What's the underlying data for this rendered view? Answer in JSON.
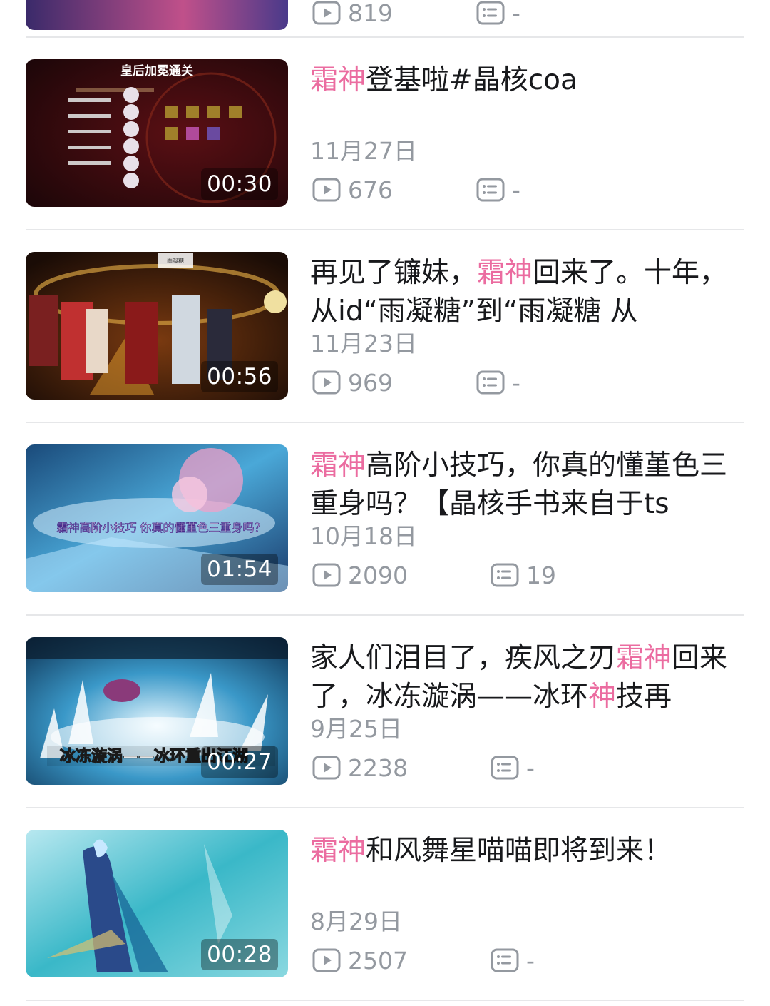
{
  "partial_top": {
    "views": "819",
    "comments": "-"
  },
  "videos": [
    {
      "title_parts": [
        {
          "text": "霜神",
          "hl": true
        },
        {
          "text": "登基啦#晶核coa",
          "hl": false
        }
      ],
      "duration": "00:30",
      "date": "11月27日",
      "views": "676",
      "comments": "-",
      "thumb_caption": "皇后加冕通关"
    },
    {
      "title_parts": [
        {
          "text": "再见了镰妹，",
          "hl": false
        },
        {
          "text": "霜神",
          "hl": true
        },
        {
          "text": "回来了。十年，从id“雨凝糖”到“雨凝糖 从",
          "hl": false
        }
      ],
      "duration": "00:56",
      "date": "11月23日",
      "views": "969",
      "comments": "-",
      "thumb_caption": "雨凝糖"
    },
    {
      "title_parts": [
        {
          "text": "霜神",
          "hl": true
        },
        {
          "text": "高阶小技巧，你真的懂堇色三重身吗？【晶核手书来自于ts",
          "hl": false
        }
      ],
      "duration": "01:54",
      "date": "10月18日",
      "views": "2090",
      "comments": "19",
      "thumb_caption": "霜神高阶小技巧 你真的懂堇色三重身吗？"
    },
    {
      "title_parts": [
        {
          "text": "家人们泪目了，疾风之刃",
          "hl": false
        },
        {
          "text": "霜神",
          "hl": true
        },
        {
          "text": "回来了，冰冻漩涡——冰环",
          "hl": false
        },
        {
          "text": "神",
          "hl": true
        },
        {
          "text": "技再",
          "hl": false
        }
      ],
      "duration": "00:27",
      "date": "9月25日",
      "views": "2238",
      "comments": "-",
      "thumb_caption": "冰冻漩涡——冰环重出江湖"
    },
    {
      "title_parts": [
        {
          "text": "霜神",
          "hl": true
        },
        {
          "text": "和风舞星喵喵即将到来！",
          "hl": false
        }
      ],
      "duration": "00:28",
      "date": "8月29日",
      "views": "2507",
      "comments": "-",
      "thumb_caption": ""
    }
  ],
  "icons": {
    "views": "play-count-icon",
    "comments": "danmaku-count-icon"
  },
  "colors": {
    "highlight": "#eb6ca0",
    "meta": "#9499a0",
    "title": "#18191c",
    "divider": "#e6e7e9"
  }
}
